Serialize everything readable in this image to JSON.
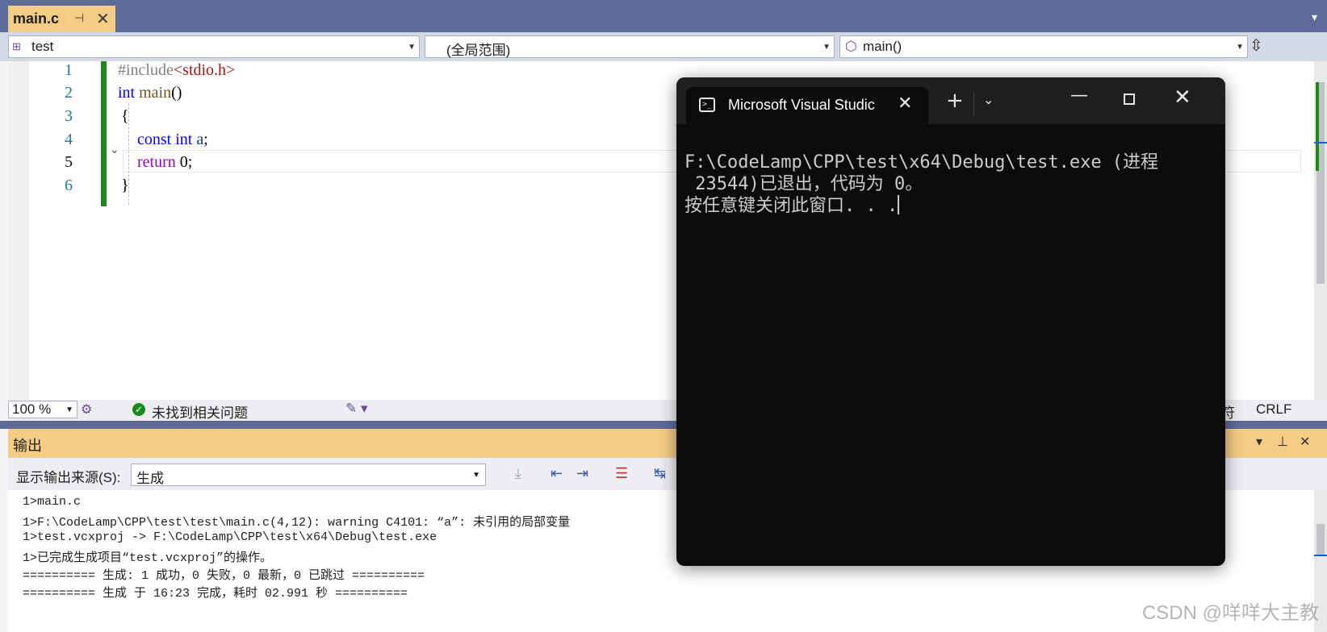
{
  "tab": {
    "title": "main.c",
    "pin_icon": "pin-icon",
    "close_icon": "close-icon"
  },
  "navbar": {
    "project": "test",
    "scope": "(全局范围)",
    "function": "main()"
  },
  "editor": {
    "line_numbers": [
      "1",
      "2",
      "3",
      "4",
      "5",
      "6"
    ],
    "lines": {
      "l1_pp": "#include",
      "l1_str": "<stdio.h>",
      "l2_kw": "int",
      "l2_fn": "main",
      "l2_rest": "()",
      "l3": "{",
      "l4_kw1": "const",
      "l4_kw2": "int",
      "l4_var": "a",
      "l4_end": ";",
      "l5_kw": "return",
      "l5_rest": " 0;",
      "l6": "}"
    }
  },
  "status": {
    "zoom": "100 %",
    "issues": "未找到相关问题",
    "tabs_label": "表符",
    "line_ending": "CRLF"
  },
  "output": {
    "title": "输出",
    "source_label": "显示输出来源(S):",
    "source_value": "生成",
    "lines": [
      "1>main.c",
      "1>F:\\CodeLamp\\CPP\\test\\test\\main.c(4,12): warning C4101: “a”: 未引用的局部变量",
      "1>test.vcxproj -> F:\\CodeLamp\\CPP\\test\\x64\\Debug\\test.exe",
      "1>已完成生成项目“test.vcxproj”的操作。",
      "========== 生成: 1 成功，0 失败，0 最新，0 已跳过 ==========",
      "========== 生成 于 16:23 完成，耗时 02.991 秒 =========="
    ]
  },
  "console": {
    "tab_title": "Microsoft Visual Studic",
    "line1": "F:\\CodeLamp\\CPP\\test\\x64\\Debug\\test.exe (进程",
    "line2": " 23544)已退出，代码为 0。",
    "line3": "按任意键关闭此窗口. . ."
  },
  "watermark": "CSDN @咩咩大主教",
  "colors": {
    "accent": "#5d6b99",
    "tab_active": "#f5cc84",
    "console_bg": "#0c0c0c"
  }
}
